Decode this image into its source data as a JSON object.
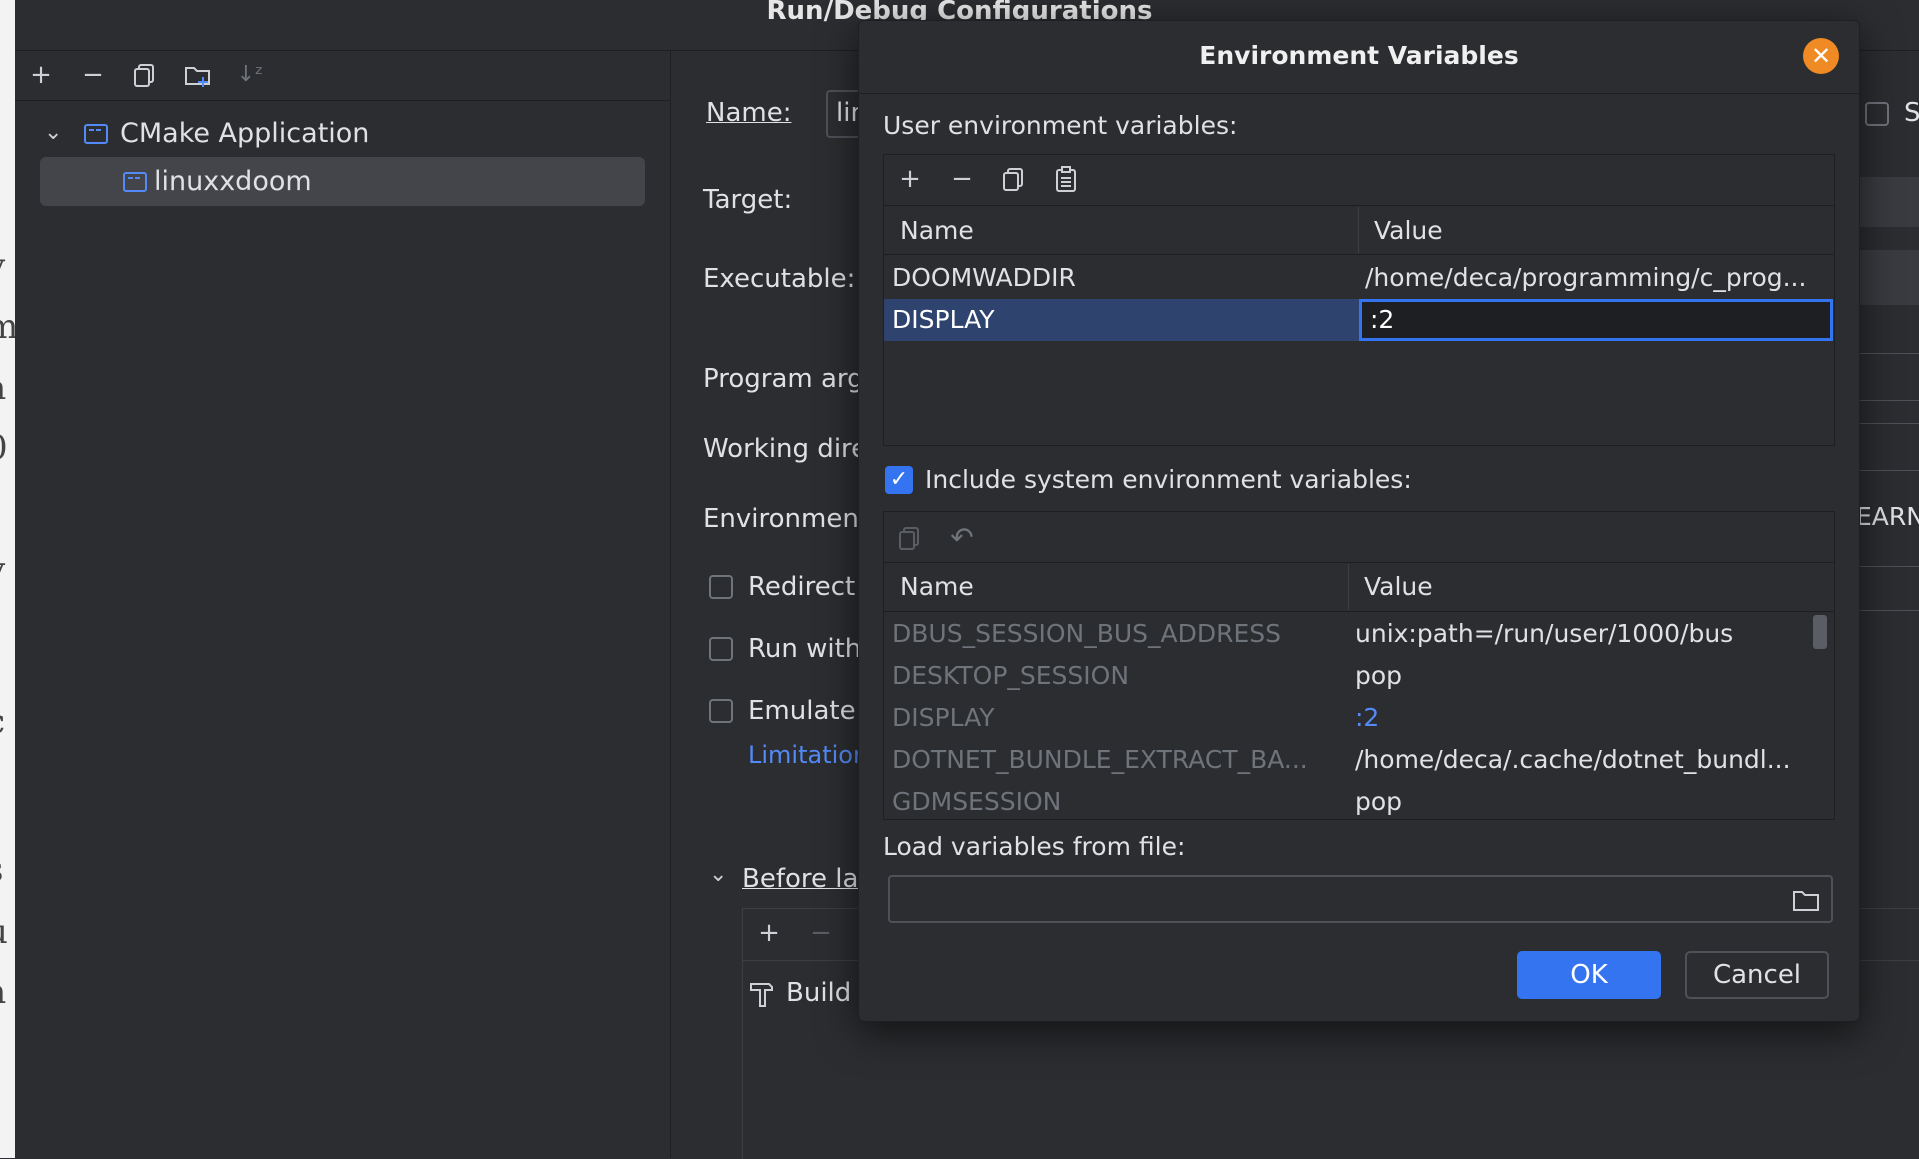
{
  "background_window": {
    "title": "Run/Debug Configurations",
    "tree": {
      "group_label": "CMake Application",
      "item_label": "linuxxdoom"
    },
    "form": {
      "name_label": "Name:",
      "name_value": "lin",
      "target_label": "Target:",
      "executable_label": "Executable:",
      "program_args_label": "Program arg",
      "working_dir_label": "Working dire",
      "environment_label": "Environment",
      "redirect_label": "Redirect",
      "run_with_label": "Run with",
      "emulate_label": "Emulate t",
      "limitations_link": "Limitation",
      "before_launch_label": "Before lau",
      "build_label": "Build",
      "right_edge_s": "S",
      "right_edge_learn": "EARN"
    }
  },
  "dialog": {
    "title": "Environment Variables",
    "user_section_label": "User environment variables:",
    "user_table": {
      "headers": [
        "Name",
        "Value"
      ],
      "rows": [
        {
          "name": "DOOMWADDIR",
          "value": "/home/deca/programming/c_prog..."
        },
        {
          "name": "DISPLAY",
          "value": ":2"
        }
      ]
    },
    "include_system_label": "Include system environment variables:",
    "include_system_checked": true,
    "system_table": {
      "headers": [
        "Name",
        "Value"
      ],
      "rows": [
        {
          "name": "DBUS_SESSION_BUS_ADDRESS",
          "value": "unix:path=/run/user/1000/bus"
        },
        {
          "name": "DESKTOP_SESSION",
          "value": "pop"
        },
        {
          "name": "DISPLAY",
          "value": ":2"
        },
        {
          "name": "DOTNET_BUNDLE_EXTRACT_BA...",
          "value": "/home/deca/.cache/dotnet_bundl..."
        },
        {
          "name": "GDMSESSION",
          "value": "pop"
        }
      ]
    },
    "load_file_label": "Load variables from file:",
    "load_file_value": "",
    "ok_label": "OK",
    "cancel_label": "Cancel"
  },
  "colors": {
    "accent": "#3574f0",
    "close_button": "#f08a24",
    "overridden_value": "#548af7",
    "dim_text": "#6f737a"
  }
}
